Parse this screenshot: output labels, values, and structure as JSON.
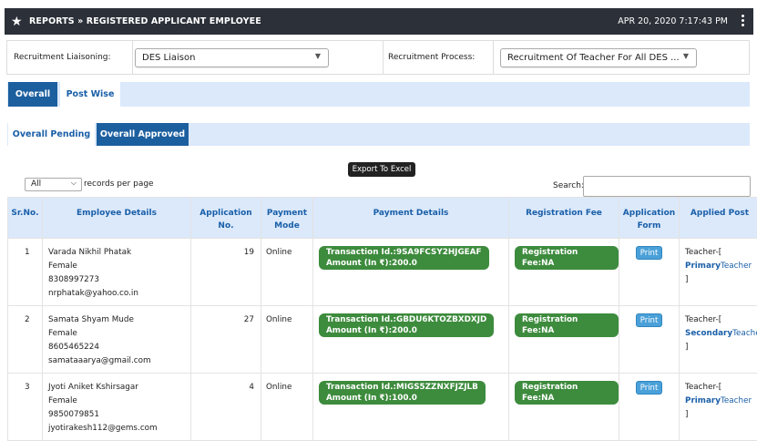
{
  "header": {
    "title": "REPORTS » REGISTERED APPLICANT EMPLOYEE",
    "datetime": "APR 20, 2020  7:17:43 PM"
  },
  "filters": {
    "liaison_label": "Recruitment Liaisoning:",
    "liaison_value": "DES Liaison",
    "process_label": "Recruitment Process:",
    "process_value": "Recruitment Of Teacher For All DES ..."
  },
  "tabs_main": [
    {
      "label": "Overall",
      "active": true
    },
    {
      "label": "Post Wise",
      "active": false
    }
  ],
  "tabs_sub": [
    {
      "label": "Overall Pending",
      "active": false
    },
    {
      "label": "Overall Approved",
      "active": true
    }
  ],
  "controls": {
    "length_value": "All",
    "records_per_page": "records per page",
    "export_label": "Export To Excel",
    "search_label": "Search:"
  },
  "table": {
    "headers": [
      "Sr.No.",
      "Employee Details",
      "Application No.",
      "Payment Mode",
      "Payment Details",
      "Registration Fee",
      "Application Form",
      "Applied Post"
    ],
    "header_lines": {
      "app_no": [
        "Application",
        "No."
      ],
      "pay_mode": [
        "Payment",
        "Mode"
      ],
      "app_form": [
        "Application",
        "Form"
      ]
    },
    "rows": [
      {
        "sr": "1",
        "name": "Varada Nikhil Phatak",
        "gender": "Female",
        "phone": "8308997273",
        "email": "nrphatak@yahoo.co.in",
        "app_no": "19",
        "mode": "Online",
        "txn": "Transaction Id.:9SA9FCSY2HJGEAF",
        "amount": "Amount (In ₹):200.0",
        "fee": "Registration Fee:NA",
        "print": "Print",
        "post_prefix": "Teacher-[",
        "post_type": "Primary",
        "post_suffix": "Teacher",
        "post_close": "]"
      },
      {
        "sr": "2",
        "name": "Samata Shyam Mude",
        "gender": "Female",
        "phone": "8605465224",
        "email": "samataaarya@gmail.com",
        "app_no": "27",
        "mode": "Online",
        "txn": "Transaction Id.:GBDU6KTOZBXDXJD",
        "amount": "Amount (In ₹):200.0",
        "fee": "Registration Fee:NA",
        "print": "Print",
        "post_prefix": "Teacher-[",
        "post_type": "Secondary",
        "post_suffix": "Teacher",
        "post_close": "]"
      },
      {
        "sr": "3",
        "name": "Jyoti Aniket Kshirsagar",
        "gender": "Female",
        "phone": "9850079851",
        "email": "jyotirakesh112@gems.com",
        "app_no": "4",
        "mode": "Online",
        "txn": "Transaction Id.:MIGS5ZZNXFJZJLB",
        "amount": "Amount (In ₹):100.0",
        "fee": "Registration Fee:NA",
        "print": "Print",
        "post_prefix": "Teacher-[",
        "post_type": "Primary",
        "post_suffix": "Teacher",
        "post_close": "]"
      }
    ]
  }
}
